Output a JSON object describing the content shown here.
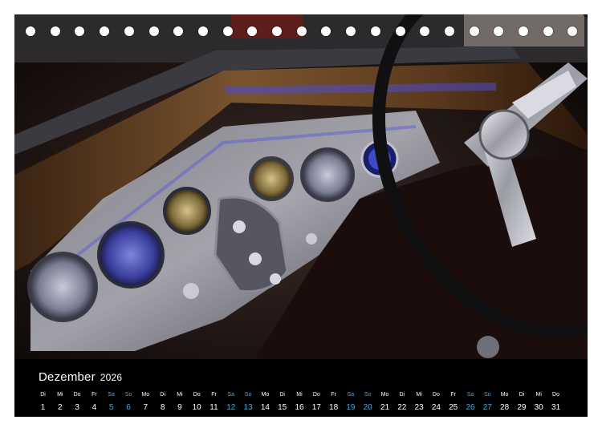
{
  "calendar": {
    "month": "Dezember",
    "year": "2026",
    "days": [
      {
        "dn": "Di",
        "num": "1",
        "weekend": false
      },
      {
        "dn": "Mi",
        "num": "2",
        "weekend": false
      },
      {
        "dn": "Do",
        "num": "3",
        "weekend": false
      },
      {
        "dn": "Fr",
        "num": "4",
        "weekend": false
      },
      {
        "dn": "Sa",
        "num": "5",
        "weekend": true
      },
      {
        "dn": "So",
        "num": "6",
        "weekend": true
      },
      {
        "dn": "Mo",
        "num": "7",
        "weekend": false
      },
      {
        "dn": "Di",
        "num": "8",
        "weekend": false
      },
      {
        "dn": "Mi",
        "num": "9",
        "weekend": false
      },
      {
        "dn": "Do",
        "num": "10",
        "weekend": false
      },
      {
        "dn": "Fr",
        "num": "11",
        "weekend": false
      },
      {
        "dn": "Sa",
        "num": "12",
        "weekend": true
      },
      {
        "dn": "So",
        "num": "13",
        "weekend": true
      },
      {
        "dn": "Mo",
        "num": "14",
        "weekend": false
      },
      {
        "dn": "Di",
        "num": "15",
        "weekend": false
      },
      {
        "dn": "Mi",
        "num": "16",
        "weekend": false
      },
      {
        "dn": "Do",
        "num": "17",
        "weekend": false
      },
      {
        "dn": "Fr",
        "num": "18",
        "weekend": false
      },
      {
        "dn": "Sa",
        "num": "19",
        "weekend": true
      },
      {
        "dn": "So",
        "num": "20",
        "weekend": true
      },
      {
        "dn": "Mo",
        "num": "21",
        "weekend": false
      },
      {
        "dn": "Di",
        "num": "22",
        "weekend": false
      },
      {
        "dn": "Mi",
        "num": "23",
        "weekend": false
      },
      {
        "dn": "Do",
        "num": "24",
        "weekend": false
      },
      {
        "dn": "Fr",
        "num": "25",
        "weekend": false
      },
      {
        "dn": "Sa",
        "num": "26",
        "weekend": true
      },
      {
        "dn": "So",
        "num": "27",
        "weekend": true
      },
      {
        "dn": "Mo",
        "num": "28",
        "weekend": false
      },
      {
        "dn": "Di",
        "num": "29",
        "weekend": false
      },
      {
        "dn": "Mi",
        "num": "30",
        "weekend": false
      },
      {
        "dn": "Do",
        "num": "31",
        "weekend": false
      }
    ]
  },
  "colors": {
    "weekend": "#4aa3d8",
    "weekday": "#ffffff",
    "background": "#000000"
  }
}
